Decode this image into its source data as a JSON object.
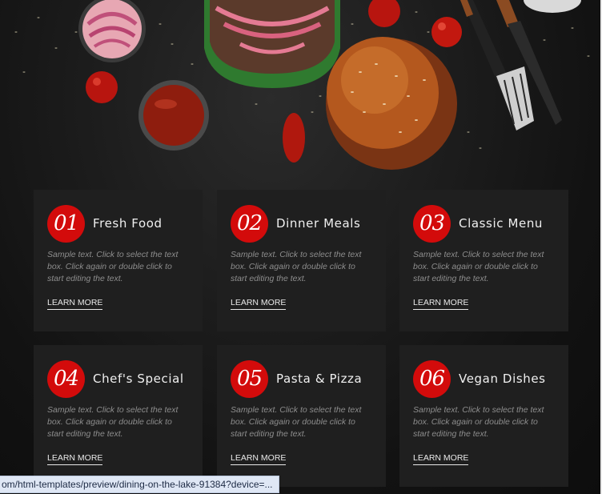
{
  "cards": [
    {
      "number": "01",
      "title": "Fresh Food",
      "text": "Sample text. Click to select the text box. Click again or double click to start editing the text.",
      "link": "LEARN MORE"
    },
    {
      "number": "02",
      "title": "Dinner Meals",
      "text": "Sample text. Click to select the text box. Click again or double click to start editing the text.",
      "link": "LEARN MORE"
    },
    {
      "number": "03",
      "title": "Classic Menu",
      "text": "Sample text. Click to select the text box. Click again or double click to start editing the text.",
      "link": "LEARN MORE"
    },
    {
      "number": "04",
      "title": "Chef's Special",
      "text": "Sample text. Click to select the text box. Click again or double click to start editing the text.",
      "link": "LEARN MORE"
    },
    {
      "number": "05",
      "title": "Pasta & Pizza",
      "text": "Sample text. Click to select the text box. Click again or double click to start editing the text.",
      "link": "LEARN MORE"
    },
    {
      "number": "06",
      "title": "Vegan Dishes",
      "text": "Sample text. Click to select the text box. Click again or double click to start editing the text.",
      "link": "LEARN MORE"
    }
  ],
  "status_url": "om/html-templates/preview/dining-on-the-lake-91384?device=...",
  "colors": {
    "accent": "#d30b0b",
    "card_bg": "#1f1f1f",
    "page_bg": "#111111"
  },
  "icons": [
    "burger-photo",
    "fork-icon",
    "knife-icon"
  ]
}
